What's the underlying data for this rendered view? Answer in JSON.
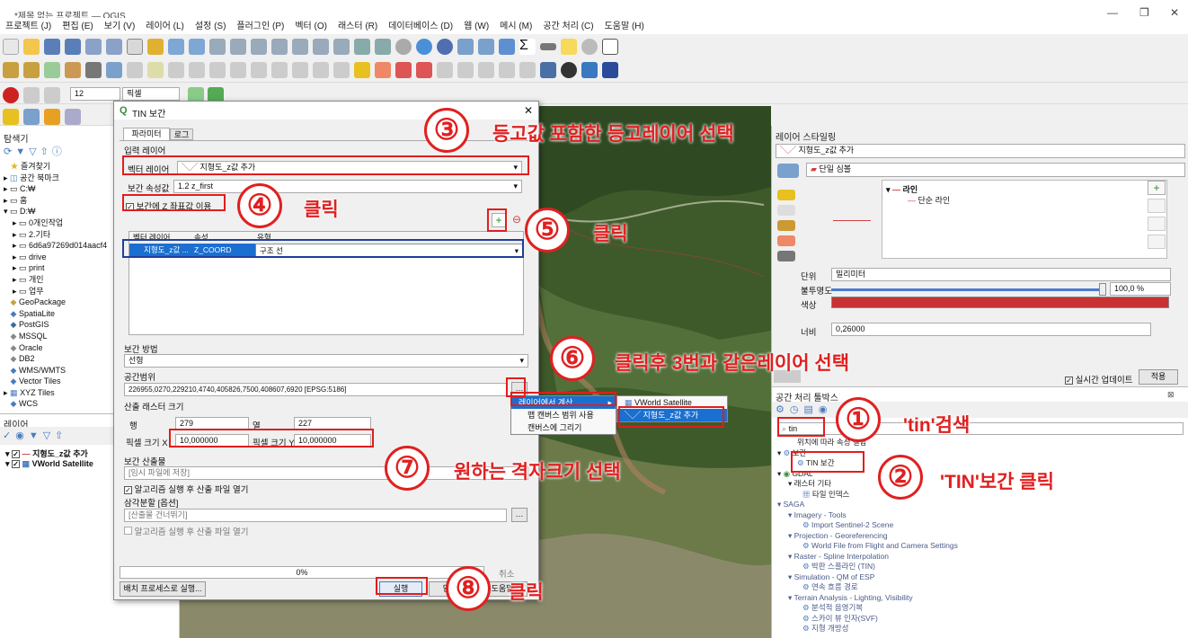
{
  "window": {
    "title": "*제목 없는 프로젝트 — QGIS",
    "ctl": [
      "—",
      "❐",
      "✕"
    ]
  },
  "menu": [
    "프로젝트 (J)",
    "편집 (E)",
    "보기 (V)",
    "레이어 (L)",
    "설정 (S)",
    "플러그인 (P)",
    "벡터 (O)",
    "래스터 (R)",
    "데이터베이스 (D)",
    "웹 (W)",
    "메시 (M)",
    "공간 처리 (C)",
    "도움말 (H)"
  ],
  "snap": {
    "value": "12",
    "unit": "픽셀"
  },
  "browser": {
    "title": "탐색기",
    "items": [
      "즐겨찾기",
      "공간 북마크",
      "C:₩",
      "홈",
      "D:₩",
      "0개인작업",
      "2.기타",
      "6d6a97269d014aacf4",
      "drive",
      "print",
      "개인",
      "업무",
      "GeoPackage",
      "SpatiaLite",
      "PostGIS",
      "MSSQL",
      "Oracle",
      "DB2",
      "WMS/WMTS",
      "Vector Tiles",
      "XYZ Tiles",
      "WCS"
    ]
  },
  "layers": {
    "title": "레이어",
    "items": [
      "지형도_z값 추가",
      "VWorld Satellite"
    ]
  },
  "dialog": {
    "title": "TIN 보간",
    "tabs": [
      "파라미터",
      "로그"
    ],
    "input_layers": "입력 레이어",
    "vector_label": "벡터 레이어",
    "vector_value": "지형도_z값 추가",
    "attr_label": "보간 속성값",
    "attr_value": "1.2  z_first",
    "use_z": "보간에 Z 좌표값 이용",
    "table_headers": [
      "벡터 레이어",
      "속성",
      "유형"
    ],
    "table_row": [
      "지형도_z값 ...",
      "Z_COORD",
      "구조 선"
    ],
    "method_label": "보간 방법",
    "method_value": "선형",
    "extent_label": "공간범위",
    "extent_value": "226955,0270,229210,4740,405826,7500,408607,6920 [EPSG:5186]",
    "raster_size": "산출 래스터 크기",
    "rows_label": "행",
    "rows": "279",
    "cols_label": "열",
    "cols": "227",
    "px_label": "픽셀 크기 X",
    "px": "10,000000",
    "py_label": "픽셀 크기 Y",
    "py": "10,000000",
    "output_label": "보간 산출물",
    "output_placeholder": "[임시 파일에 저장]",
    "open_after": "알고리즘 실행 후 산출 파일 열기",
    "tri_label": "삼각분할 [옵션]",
    "tri_placeholder": "[산출물 건너뛰기]",
    "open_after2": "알고리즘 실행 후 산출 파일 열기",
    "progress": "0%",
    "cancel": "취소",
    "batch": "배치 프로세스로 실행...",
    "run": "실행",
    "close": "닫기",
    "help": "도움말"
  },
  "extent_menu": [
    "레이어에서 계산",
    "맵 캔버스 범위 사용",
    "캔버스에 그리기"
  ],
  "extent_submenu": [
    "VWorld Satellite",
    "지형도_z값 추가"
  ],
  "style": {
    "title": "레이어 스타일링",
    "layer": "지형도_z값 추가",
    "renderer": "단일 심볼",
    "tree": [
      "라인",
      "단순 라인"
    ],
    "unit_label": "단위",
    "unit": "밀리미터",
    "opacity_label": "불투명도",
    "opacity": "100,0 %",
    "color_label": "색상",
    "color": "#c83232",
    "width_label": "너비",
    "width": "0,26000",
    "live_update": "실시간 업데이트",
    "apply": "적용"
  },
  "toolbox": {
    "title": "공간 처리 툴박스",
    "search": "tin",
    "items": [
      "위치에 따라 속성 결합",
      "보간",
      "TIN 보간",
      "GDAL",
      "래스터 기타",
      "타일 인덱스",
      "SAGA",
      "Imagery - Tools",
      "Import Sentinel-2 Scene",
      "Projection - Georeferencing",
      "World File from Flight and Camera Settings",
      "Raster - Spline Interpolation",
      "박판 스플라인 (TIN)",
      "Simulation - QM of ESP",
      "연속 흐름 경로",
      "Terrain Analysis - Lighting, Visibility",
      "분석적 음영기복",
      "스카이 뷰 인자(SVF)",
      "지형 개방성"
    ]
  },
  "annotations": [
    {
      "n": "①",
      "t": "'tin'검색"
    },
    {
      "n": "②",
      "t": "'TIN'보간 클릭"
    },
    {
      "n": "③",
      "t": "등고값 포함한 등고레이어 선택"
    },
    {
      "n": "④",
      "t": "클릭"
    },
    {
      "n": "⑤",
      "t": "클릭"
    },
    {
      "n": "⑥",
      "t": "클릭후 3번과 같은레이어 선택"
    },
    {
      "n": "⑦",
      "t": "원하는 격자크기 선택"
    },
    {
      "n": "⑧",
      "t": "클릭"
    }
  ]
}
